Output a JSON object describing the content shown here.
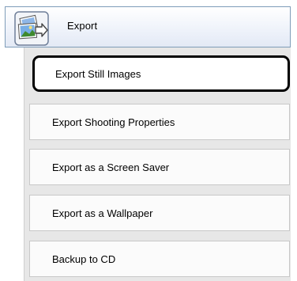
{
  "header": {
    "label": "Export",
    "icon": "export-photos-icon"
  },
  "submenu": {
    "items": [
      {
        "label": "Export Still Images",
        "selected": true
      },
      {
        "label": "Export Shooting Properties",
        "selected": false
      },
      {
        "label": "Export as a Screen Saver",
        "selected": false
      },
      {
        "label": "Export as a Wallpaper",
        "selected": false
      },
      {
        "label": "Backup to CD",
        "selected": false
      }
    ]
  },
  "colors": {
    "header_border": "#7f9db9",
    "submenu_bg": "#e7e7e7",
    "item_bg": "#fbfbfb",
    "selected_outline": "#000000"
  }
}
